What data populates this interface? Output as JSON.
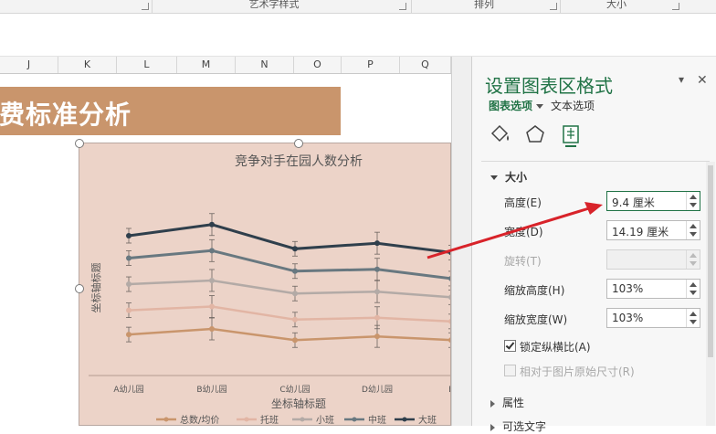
{
  "ribbon": {
    "groups": [
      "艺术字样式",
      "排列",
      "大小"
    ]
  },
  "sheet": {
    "columns": [
      "J",
      "K",
      "L",
      "M",
      "N",
      "O",
      "P",
      "Q"
    ],
    "banner_text": "收费标准分析"
  },
  "chart_data": {
    "type": "line",
    "title": "竞争对手在园人数分析",
    "xlabel": "坐标轴标题",
    "ylabel": "坐标轴标题",
    "categories": [
      "A幼儿园",
      "B幼儿园",
      "C幼儿园",
      "D幼儿园",
      "E"
    ],
    "ylim": [
      0,
      100
    ],
    "series": [
      {
        "name": "总数/均价",
        "color": "#c9956c",
        "values": [
          22,
          25,
          19,
          21,
          19
        ]
      },
      {
        "name": "托班",
        "color": "#e2b5a4",
        "values": [
          35,
          37,
          30,
          31,
          29
        ]
      },
      {
        "name": "小班",
        "color": "#b3aaa6",
        "values": [
          49,
          51,
          44,
          45,
          42
        ]
      },
      {
        "name": "中班",
        "color": "#687880",
        "values": [
          63,
          67,
          56,
          57,
          52
        ]
      },
      {
        "name": "大班",
        "color": "#2f3f4c",
        "values": [
          75,
          81,
          68,
          71,
          66
        ]
      }
    ]
  },
  "pane": {
    "title": "设置图表区格式",
    "tab_chart_options": "图表选项",
    "tab_text_options": "文本选项",
    "icons": [
      "fill-bucket-icon",
      "pentagon-icon",
      "size-properties-icon"
    ],
    "section_size": "大小",
    "fields": {
      "height_label": "高度(E)",
      "height_value": "9.4 厘米",
      "width_label": "宽度(D)",
      "width_value": "14.19 厘米",
      "rotation_label": "旋转(T)",
      "rotation_value": "",
      "scale_height_label": "缩放高度(H)",
      "scale_height_value": "103%",
      "scale_width_label": "缩放宽度(W)",
      "scale_width_value": "103%"
    },
    "lock_aspect_label": "锁定纵横比(A)",
    "lock_aspect_checked": true,
    "relative_label": "相对于图片原始尺寸(R)",
    "section_properties": "属性",
    "section_alt": "可选文字"
  },
  "annotation": {
    "arrow_color": "#d8232a"
  }
}
